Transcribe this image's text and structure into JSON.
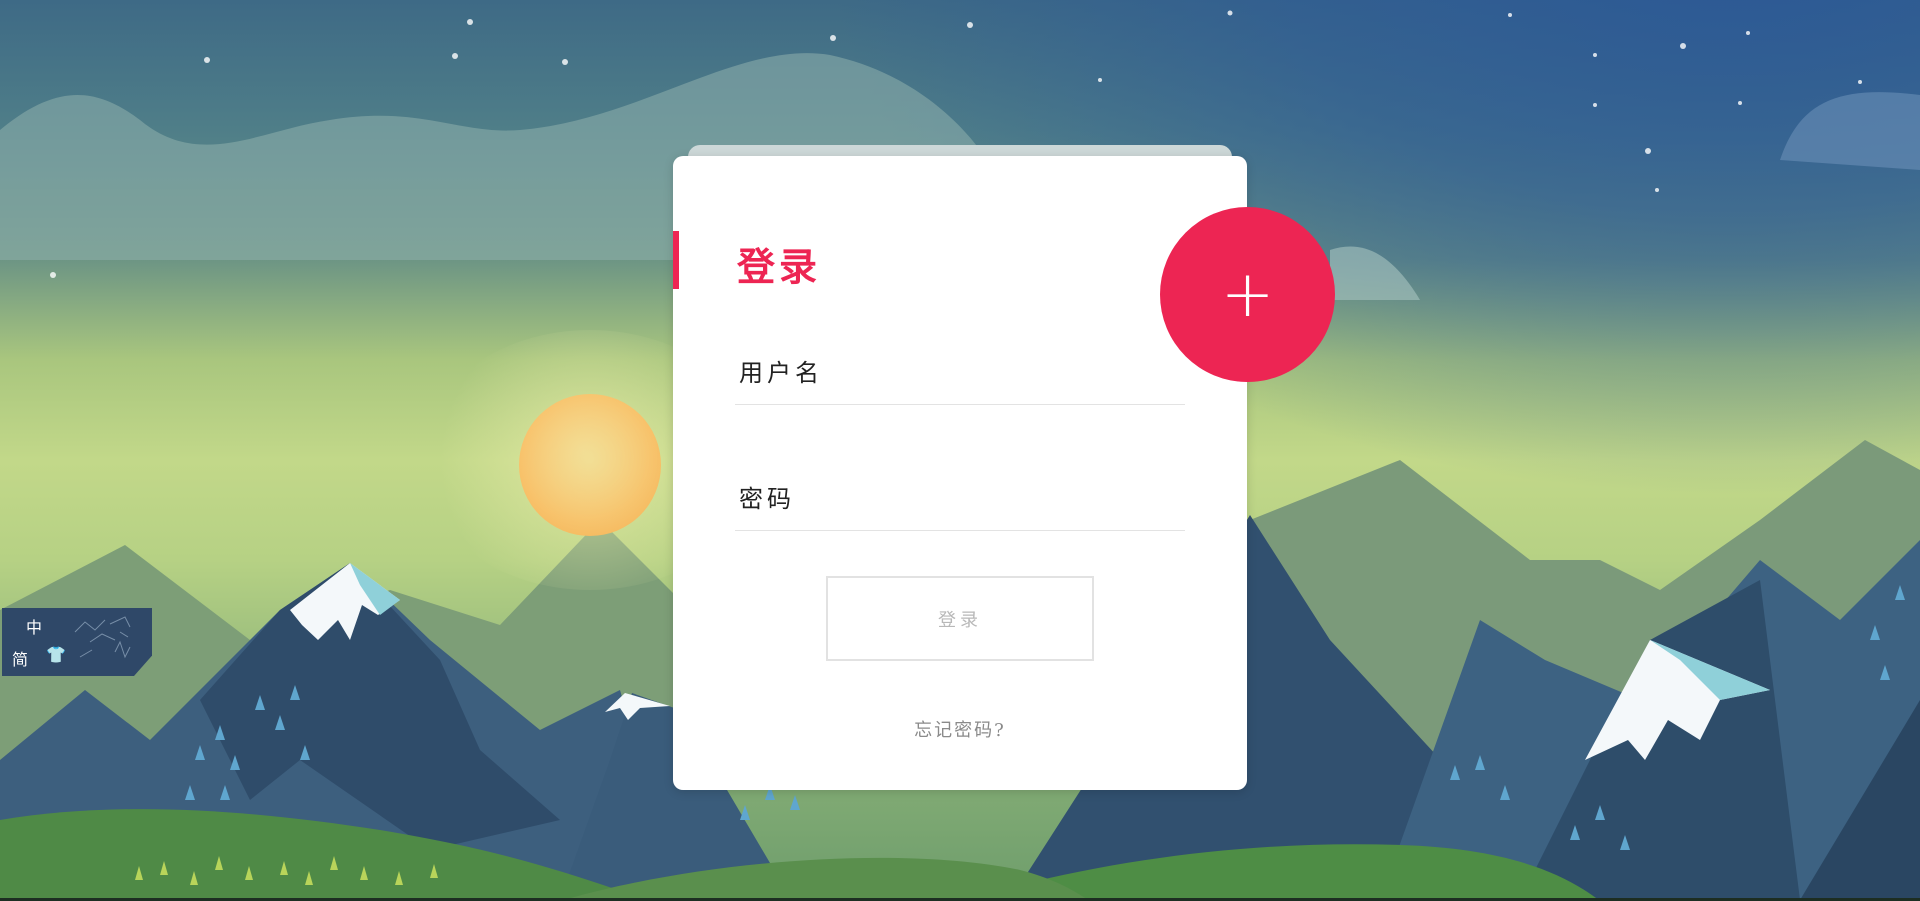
{
  "login_card": {
    "title": "登录",
    "username_placeholder": "用户名",
    "password_placeholder": "密码",
    "submit_label": "登录",
    "forgot_link": "忘记密码?"
  },
  "fab": {
    "icon": "plus-icon",
    "symbol": "+"
  },
  "language_widget": {
    "top_char": "中",
    "bottom_char": "简",
    "skin_icon": "shirt-icon"
  },
  "colors": {
    "accent": "#ed2553",
    "sun": "#ffa642",
    "widget_bg": "#2f4868"
  }
}
